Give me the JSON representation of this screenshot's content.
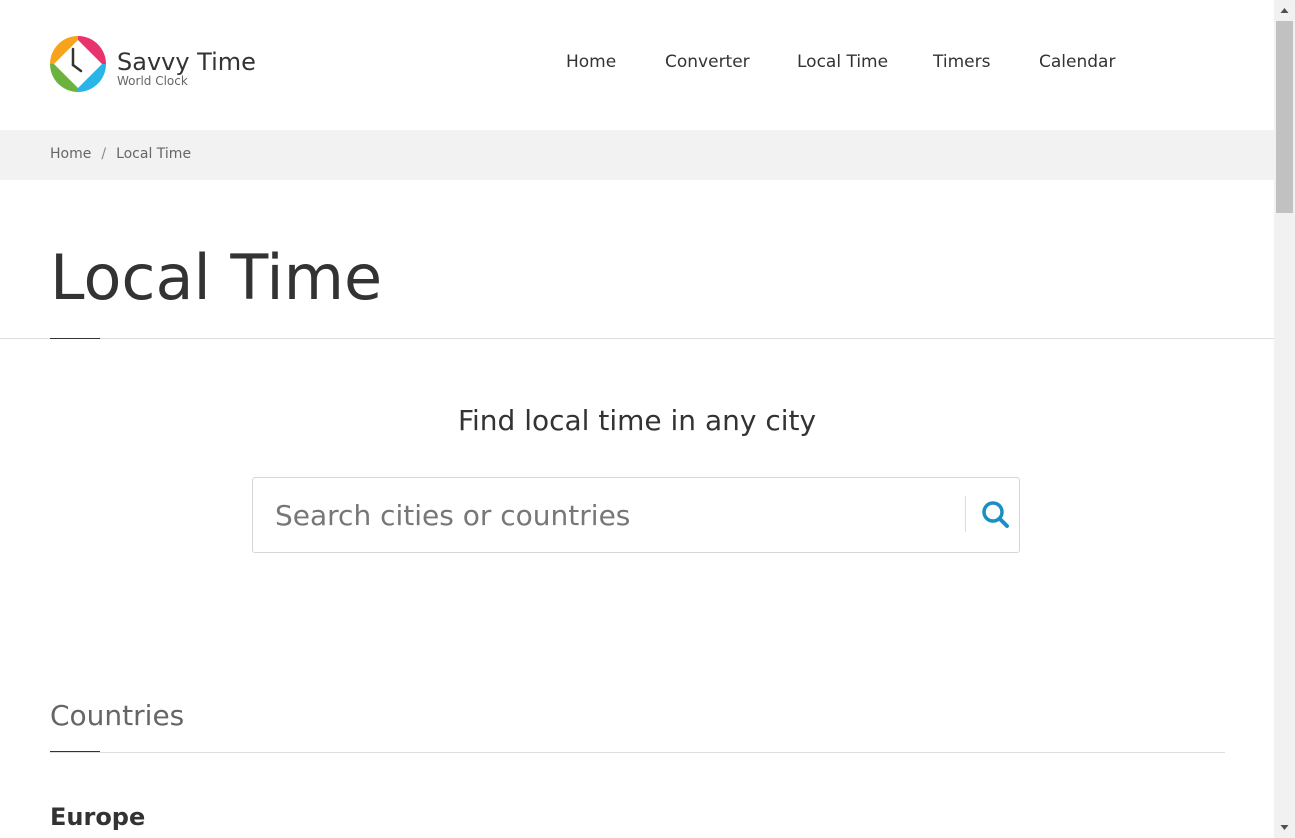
{
  "header": {
    "brand_name": "Savvy Time",
    "brand_sub": "World Clock",
    "nav": [
      "Home",
      "Converter",
      "Local Time",
      "Timers",
      "Calendar"
    ]
  },
  "breadcrumb": {
    "items": [
      "Home",
      "Local Time"
    ],
    "separator": "/"
  },
  "main": {
    "title": "Local Time",
    "search": {
      "heading": "Find local time in any city",
      "placeholder": "Search cities or countries",
      "value": ""
    },
    "countries": {
      "title": "Countries",
      "regions": [
        "Europe"
      ]
    }
  },
  "icons": {
    "logo": "clock-logo-icon",
    "search": "search-icon",
    "scroll_up": "arrow-up-icon",
    "scroll_down": "arrow-down-icon"
  },
  "colors": {
    "accent": "#1a8fc6",
    "text": "#333333",
    "muted": "#666666",
    "breadcrumb_bg": "#f2f2f2",
    "logo_pink": "#e8336d",
    "logo_orange": "#f7a31c",
    "logo_green": "#6cb33e",
    "logo_blue": "#29b5e8"
  }
}
